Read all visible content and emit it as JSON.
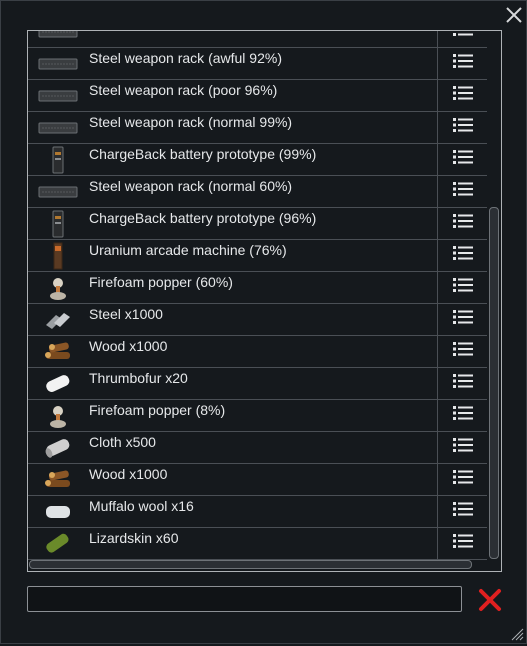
{
  "window": {
    "close_icon": "close-icon",
    "resize_icon": "resize-grip-icon"
  },
  "list": {
    "items": [
      {
        "label": "",
        "icon": "steel-weapon-rack-icon"
      },
      {
        "label": "Steel weapon rack (awful 92%)",
        "icon": "steel-weapon-rack-icon"
      },
      {
        "label": "Steel weapon rack (poor 96%)",
        "icon": "steel-weapon-rack-icon"
      },
      {
        "label": "Steel weapon rack (normal 99%)",
        "icon": "steel-weapon-rack-icon"
      },
      {
        "label": "ChargeBack battery prototype (99%)",
        "icon": "battery-icon"
      },
      {
        "label": "Steel weapon rack (normal 60%)",
        "icon": "steel-weapon-rack-icon"
      },
      {
        "label": "ChargeBack battery prototype (96%)",
        "icon": "battery-icon"
      },
      {
        "label": "Uranium arcade machine (76%)",
        "icon": "arcade-machine-icon"
      },
      {
        "label": "Firefoam popper (60%)",
        "icon": "firefoam-popper-icon"
      },
      {
        "label": "Steel x1000",
        "icon": "steel-icon"
      },
      {
        "label": "Wood x1000",
        "icon": "wood-icon"
      },
      {
        "label": "Thrumbofur x20",
        "icon": "thrumbofur-icon"
      },
      {
        "label": "Firefoam popper (8%)",
        "icon": "firefoam-popper-icon"
      },
      {
        "label": "Cloth x500",
        "icon": "cloth-icon"
      },
      {
        "label": "Wood x1000",
        "icon": "wood-icon"
      },
      {
        "label": "Muffalo wool x16",
        "icon": "muffalo-wool-icon"
      },
      {
        "label": "Lizardskin x60",
        "icon": "lizardskin-icon"
      }
    ],
    "row_menu_icon": "list-menu-icon"
  },
  "search": {
    "value": "",
    "placeholder": ""
  },
  "clear_button_icon": "clear-x-icon",
  "colors": {
    "background": "#15191d",
    "row_divider": "#4a4f55",
    "text": "#e6e8ea",
    "clear_red": "#e02020"
  }
}
